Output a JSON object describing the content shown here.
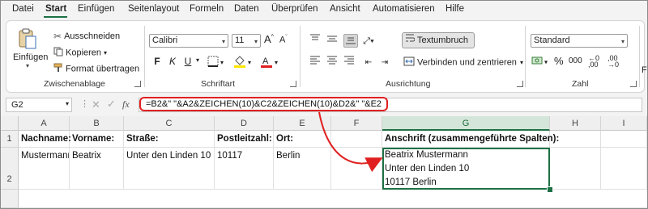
{
  "menu": {
    "tabs": [
      "Datei",
      "Start",
      "Einfügen",
      "Seitenlayout",
      "Formeln",
      "Daten",
      "Überprüfen",
      "Ansicht",
      "Automatisieren",
      "Hilfe"
    ],
    "active": "Start"
  },
  "ribbon": {
    "clipboard": {
      "paste_label": "Einfügen",
      "cut_label": "Ausschneiden",
      "copy_label": "Kopieren",
      "format_painter_label": "Format übertragen",
      "group_label": "Zwischenablage"
    },
    "font": {
      "font_name": "Calibri",
      "font_size": "11",
      "bold": "F",
      "italic": "K",
      "underline": "U",
      "grow": "A",
      "shrink": "A",
      "group_label": "Schriftart"
    },
    "alignment": {
      "wrap_label": "Textumbruch",
      "merge_label": "Verbinden und zentrieren",
      "group_label": "Ausrichtung"
    },
    "number": {
      "format": "Standard",
      "percent": "%",
      "thousands": "000",
      "group_label": "Zahl"
    },
    "styles": {
      "partial_label": "Fo"
    }
  },
  "formula_bar": {
    "name_box": "G2",
    "fx": "fx",
    "formula": "=B2&\" \"&A2&ZEICHEN(10)&C2&ZEICHEN(10)&D2&\" \"&E2"
  },
  "columns": [
    "A",
    "B",
    "C",
    "D",
    "E",
    "F",
    "G",
    "H",
    "I"
  ],
  "selected_column": "G",
  "rows": [
    "1",
    "2"
  ],
  "cells": {
    "A1": "Nachname:",
    "B1": "Vorname:",
    "C1": "Straße:",
    "D1": "Postleitzahl:",
    "E1": "Ort:",
    "G1": "Anschrift (zusammengeführte Spalten):",
    "A2": "Mustermann",
    "B2": "Beatrix",
    "C2": "Unter den Linden 10",
    "D2": "10117",
    "E2": "Berlin",
    "G2_lines": [
      "Beatrix Mustermann",
      "Unter den Linden 10",
      "10117 Berlin"
    ]
  },
  "colors": {
    "accent": "#1e7145",
    "highlight": "#e02020"
  }
}
